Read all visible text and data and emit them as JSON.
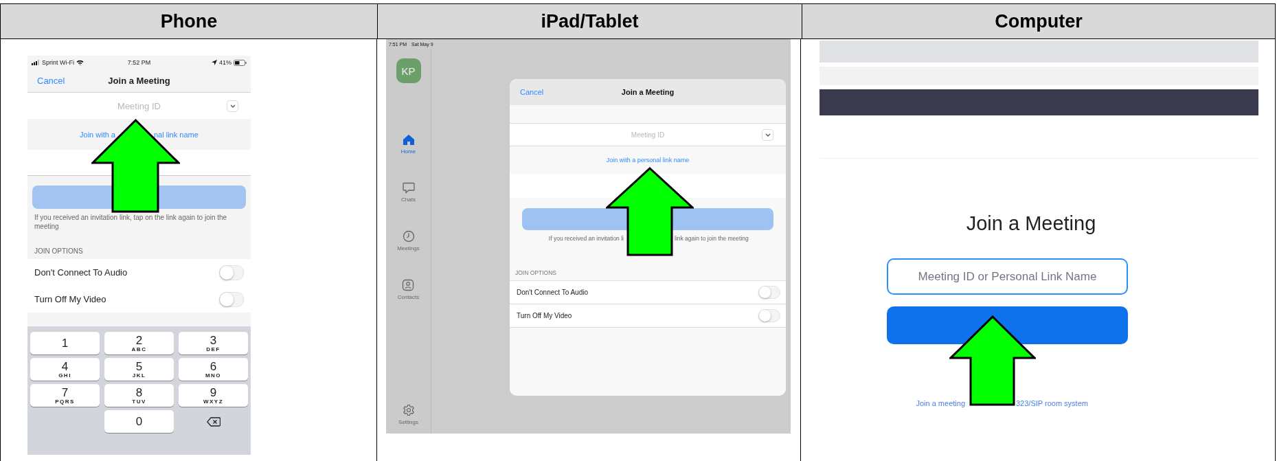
{
  "table": {
    "columns": [
      {
        "heading": "Phone"
      },
      {
        "heading": "iPad/Tablet"
      },
      {
        "heading": "Computer"
      }
    ]
  },
  "phone": {
    "status": {
      "carrier": "Sprint Wi-Fi",
      "time": "7:52 PM",
      "battery": "41%"
    },
    "nav": {
      "cancel": "Cancel",
      "title": "Join a Meeting"
    },
    "meeting_id": {
      "placeholder": "Meeting ID"
    },
    "link_parts": [
      "Join with a",
      "nal link name"
    ],
    "hint": "If you received an invitation link, tap on the link again to join the meeting",
    "section": "JOIN OPTIONS",
    "options": [
      {
        "label": "Don't Connect To Audio",
        "on": false
      },
      {
        "label": "Turn Off My Video",
        "on": false
      }
    ],
    "keys": [
      {
        "kind": "digit",
        "digit": "1"
      },
      {
        "kind": "digit",
        "digit": "2",
        "letters": "ABC"
      },
      {
        "kind": "digit",
        "digit": "3",
        "letters": "DEF"
      },
      {
        "kind": "digit",
        "digit": "4",
        "letters": "GHI"
      },
      {
        "kind": "digit",
        "digit": "5",
        "letters": "JKL"
      },
      {
        "kind": "digit",
        "digit": "6",
        "letters": "MNO"
      },
      {
        "kind": "digit",
        "digit": "7",
        "letters": "PQRS"
      },
      {
        "kind": "digit",
        "digit": "8",
        "letters": "TUV"
      },
      {
        "kind": "digit",
        "digit": "9",
        "letters": "WXYZ"
      },
      {
        "kind": "blank"
      },
      {
        "kind": "digit",
        "digit": "0"
      },
      {
        "kind": "delete"
      }
    ]
  },
  "tablet": {
    "status": {
      "time": "7:51 PM",
      "date": "Sat May 9"
    },
    "avatar": "KP",
    "sidebar": {
      "items": [
        {
          "kind": "home",
          "label": "Home",
          "selected": true
        },
        {
          "kind": "chats",
          "label": "Chats",
          "selected": false
        },
        {
          "kind": "meetings",
          "label": "Meetings",
          "selected": false
        },
        {
          "kind": "contacts",
          "label": "Contacts",
          "selected": false
        }
      ],
      "bottom_item": {
        "kind": "settings",
        "label": "Settings",
        "selected": false
      }
    },
    "dialog": {
      "cancel": "Cancel",
      "title": "Join a Meeting",
      "meeting_id": {
        "placeholder": "Meeting ID"
      },
      "link": "Join with a personal link name",
      "hint_parts": [
        "If you received an invitation li",
        "link again to join the meeting"
      ],
      "section": "JOIN OPTIONS",
      "options": [
        {
          "label": "Don't Connect To Audio",
          "on": false
        },
        {
          "label": "Turn Off My Video",
          "on": false
        }
      ]
    }
  },
  "computer": {
    "title": "Join a Meeting",
    "field": {
      "placeholder": "Meeting ID or Personal Link Name"
    },
    "link_parts": [
      "Join a meeting",
      "323/SIP room system"
    ]
  }
}
